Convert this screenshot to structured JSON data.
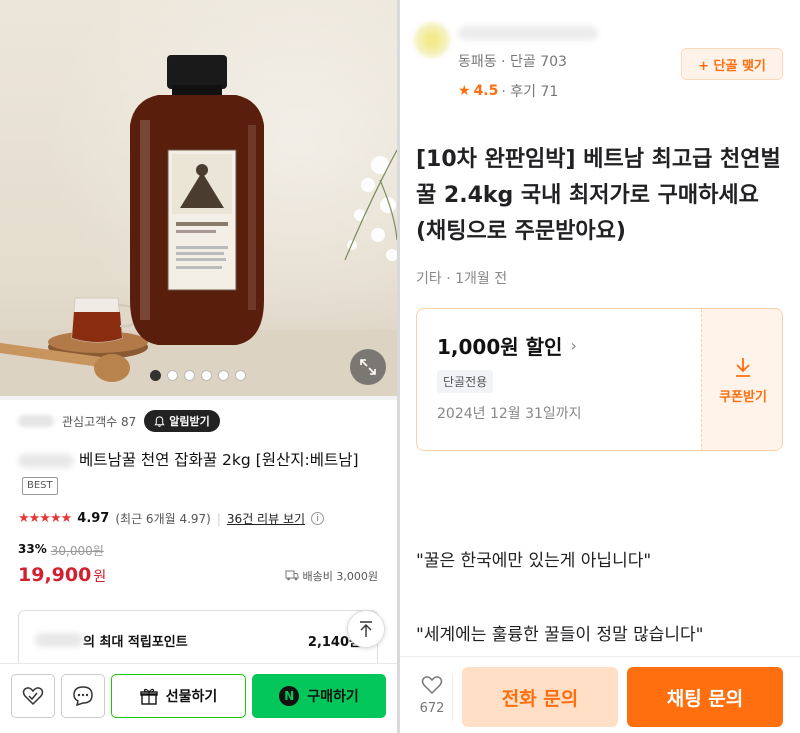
{
  "left": {
    "gallery": {
      "image_alt": "honey bottle product photo",
      "label_lines": [
        "Best of honey",
        "HONEY",
        "Raw Natural"
      ],
      "dot_count": 6,
      "active_dot": 0
    },
    "store_meta": {
      "interest_label": "관심고객수 87",
      "alarm_button": "알림받기"
    },
    "product": {
      "title": "베트남꿀 천연 잡화꿀 2kg [원산지:베트남]",
      "badge": "BEST",
      "stars": "★★★★★",
      "rating": "4.97",
      "rating_note": "(최근 6개월 4.97)",
      "review_link": "36건 리뷰 보기",
      "discount_rate": "33%",
      "original_price": "30,000원",
      "price": "19,900",
      "price_unit": "원",
      "shipping": "배송비 3,000원"
    },
    "points": {
      "label": "의 최대 적립포인트",
      "value": "2,140원"
    },
    "bottom_bar": {
      "gift_label": "선물하기",
      "buy_label": "구매하기",
      "npay_mark": "N"
    }
  },
  "right": {
    "seller": {
      "location": "동패동 · 단골 703",
      "rating": "4.5",
      "reviews": "· 후기 71",
      "regular_button": "+ 단골 맺기"
    },
    "post": {
      "title": "[10차 완판임박] 베트남 최고급 천연벌꿀 2.4kg 국내 최저가로 구매하세요 (채팅으로 주문받아요)",
      "meta": "기타 · 1개월 전"
    },
    "coupon": {
      "amount": "1,000원 할인",
      "tag": "단골전용",
      "expiry": "2024년 12월 31일까지",
      "receive_label": "쿠폰받기"
    },
    "quotes": [
      "\"꿀은 한국에만 있는게 아닙니다\"",
      "\"세계에는 훌륭한 꿀들이 정말 많습니다\""
    ],
    "bottom_bar": {
      "like_count": "672",
      "phone_label": "전화 문의",
      "chat_label": "채팅 문의"
    }
  },
  "colors": {
    "naver_green": "#03c75a",
    "price_red": "#d41f2e",
    "karrot_orange": "#ff6f0f"
  }
}
